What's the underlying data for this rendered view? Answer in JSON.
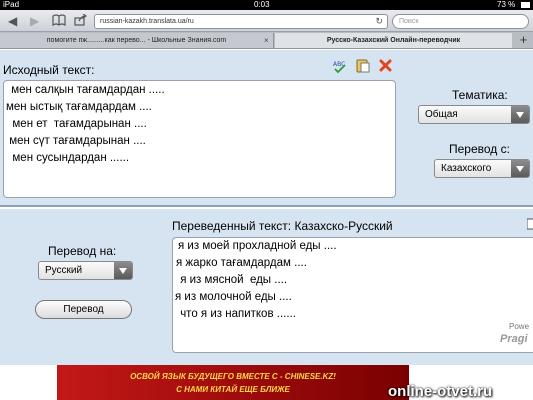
{
  "status": {
    "device": "iPad",
    "time": "0:03",
    "battery": "73 %"
  },
  "browser": {
    "url": "russian-kazakh.translata.ua/ru",
    "search_placeholder": "Поиск",
    "tabs": [
      {
        "label": "помогите пж.........как перево... - Школьные Знания.com"
      },
      {
        "label": "Русско-Казахский Онлайн-переводчик"
      }
    ],
    "tab_close": "×",
    "tab_add": "+"
  },
  "source": {
    "label": "Исходный текст:",
    "lines": [
      " мен салқын тағамдардан .....",
      "мен ыстық тағамдардам ....",
      "  мен ет  тағамдарынан ....",
      " мен сүт тағамдарынан ....",
      "  мен сусындардан ......"
    ]
  },
  "theme": {
    "label": "Тематика:",
    "value": "Общая"
  },
  "from_lang": {
    "label": "Перевод с:",
    "value": "Казахского"
  },
  "to_lang": {
    "label": "Перевод на:",
    "value": "Русский"
  },
  "translate_button": "Перевод",
  "result": {
    "label": "Переведенный текст: Казахско-Русский",
    "lines": [
      "я из моей прохладной еды ....",
      "я жарко тағамдардам ....",
      " я из мясной  еды ....",
      "я из молочной еды ....",
      " что я из напитков ......"
    ]
  },
  "ad": {
    "line1": "ОСВОЙ ЯЗЫК БУДУЩЕГО ВМЕСТЕ С - CHINESE.KZ!",
    "line2": "С НАМИ КИТАЙ ЕЩЕ БЛИЖЕ"
  },
  "watermark": "online-otvet.ru",
  "powered_by": "Powe",
  "logo_text": "Pragi"
}
